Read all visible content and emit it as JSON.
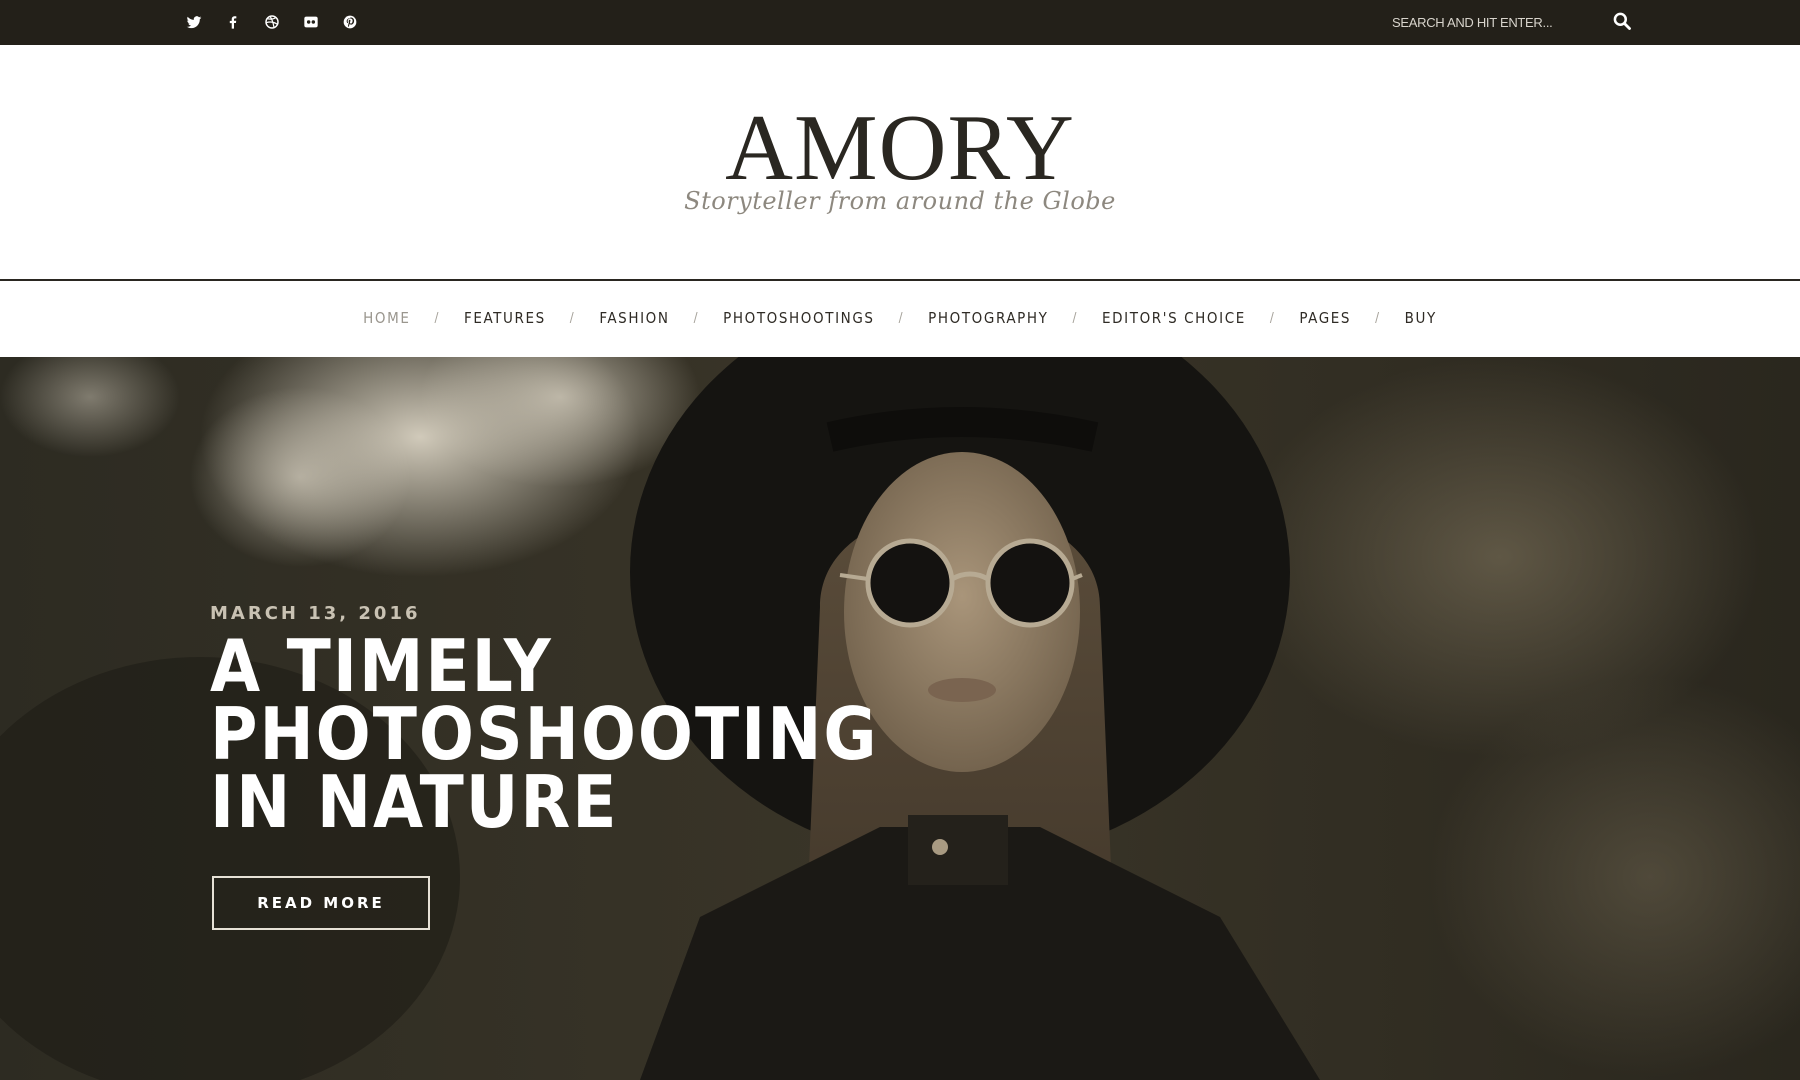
{
  "topbar": {
    "social": [
      {
        "name": "twitter-icon"
      },
      {
        "name": "facebook-icon"
      },
      {
        "name": "dribbble-icon"
      },
      {
        "name": "flickr-icon"
      },
      {
        "name": "pinterest-icon"
      }
    ],
    "search": {
      "placeholder": "SEARCH AND HIT ENTER...",
      "icon": "search-icon"
    },
    "background": "#232019"
  },
  "header": {
    "logo": "AMORY",
    "tagline": "Storyteller from around the Globe"
  },
  "nav": {
    "items": [
      {
        "label": "Home",
        "active": true
      },
      {
        "label": "Features"
      },
      {
        "label": "Fashion"
      },
      {
        "label": "Photoshootings"
      },
      {
        "label": "Photography"
      },
      {
        "label": "Editor's Choice"
      },
      {
        "label": "Pages"
      },
      {
        "label": "Buy"
      }
    ],
    "separator": "/"
  },
  "hero": {
    "date": "MARCH 13, 2016",
    "title": "A TIMELY PHOTOSHOOTING IN NATURE",
    "button": "READ MORE",
    "tone": "#2b2920"
  }
}
